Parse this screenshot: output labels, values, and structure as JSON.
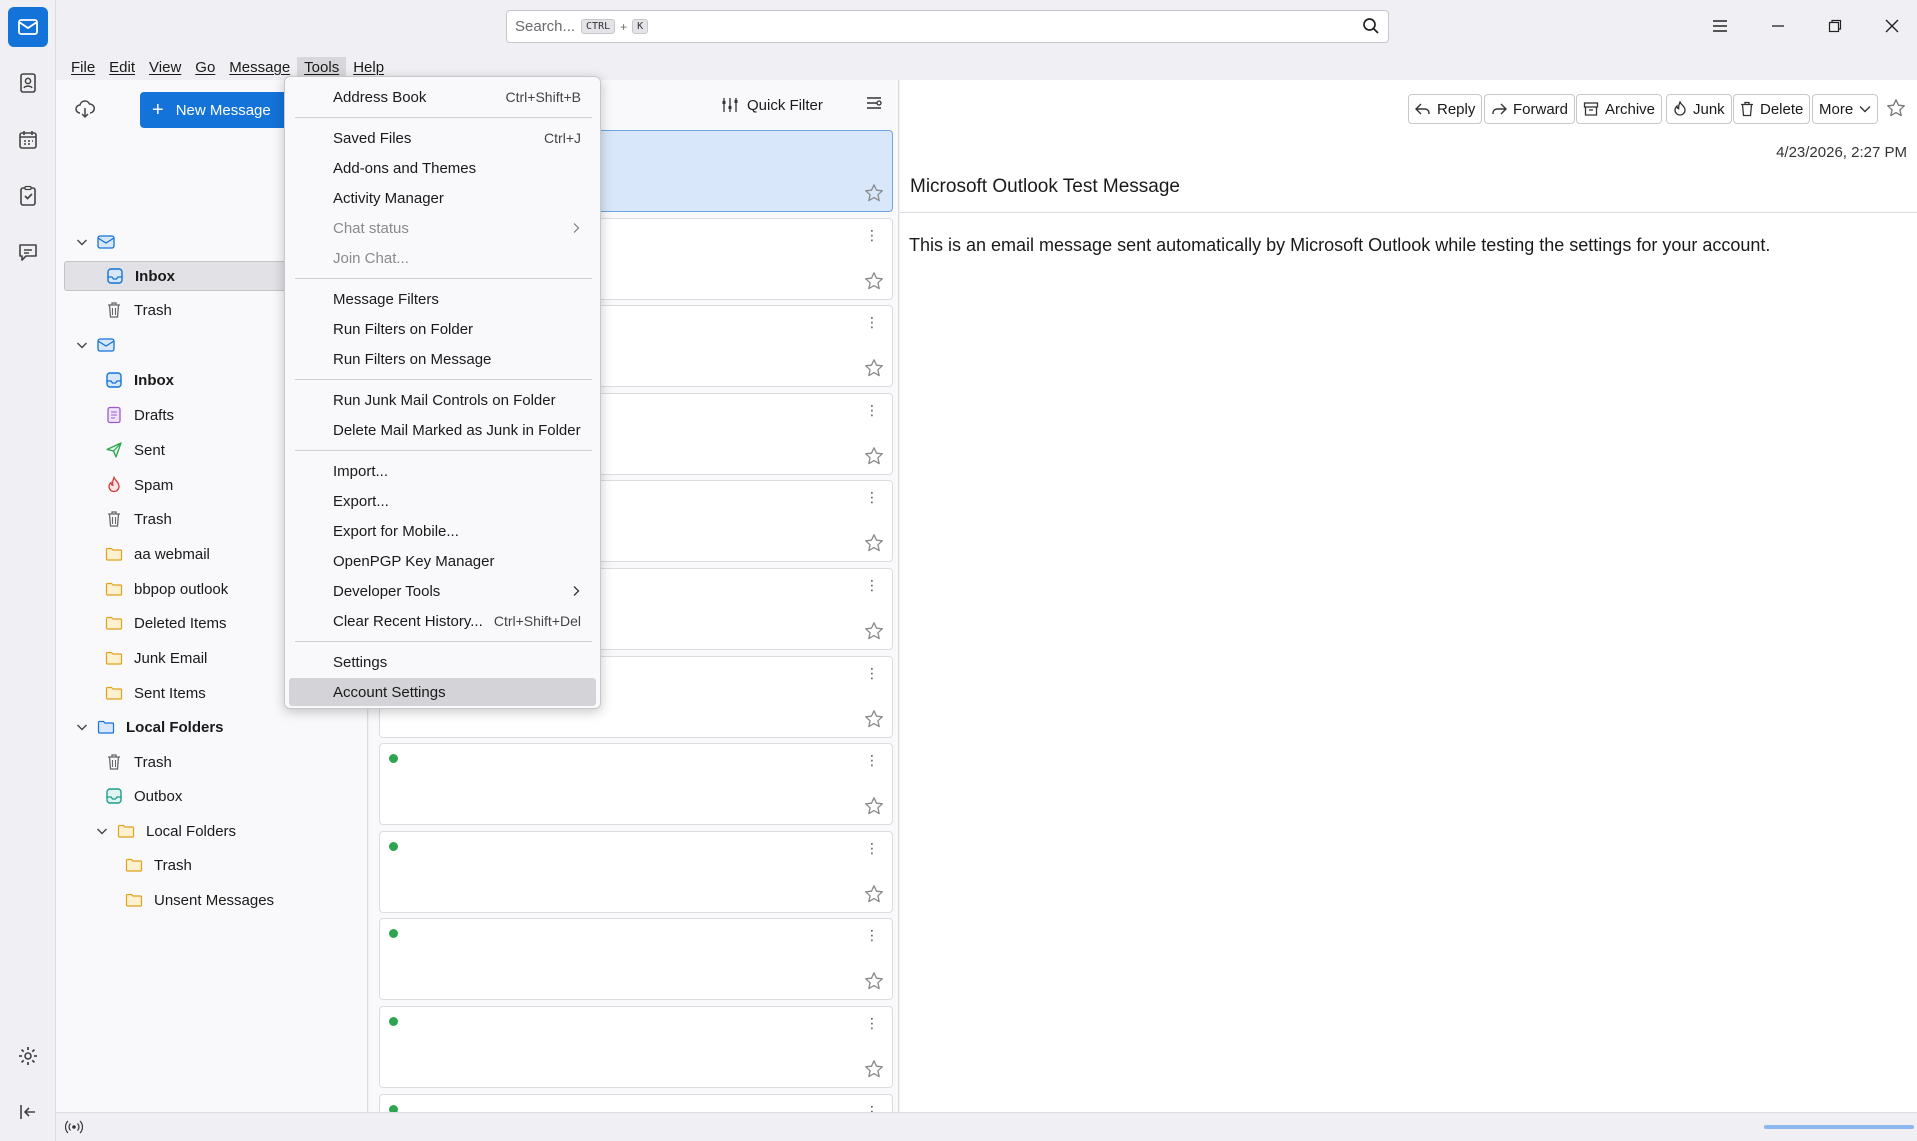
{
  "search": {
    "placeholder": "Search...",
    "shortcut_ctrl": "CTRL",
    "shortcut_plus": "+",
    "shortcut_key": "K"
  },
  "menubar": [
    "File",
    "Edit",
    "View",
    "Go",
    "Message",
    "Tools",
    "Help"
  ],
  "folders": {
    "new_message": "New Message",
    "account1": {
      "inbox": "Inbox",
      "trash": "Trash"
    },
    "account2": {
      "inbox": "Inbox",
      "drafts": "Drafts",
      "sent": "Sent",
      "spam": "Spam",
      "trash": "Trash",
      "aa_webmail": "aa webmail",
      "bbpop_outlook": "bbpop outlook",
      "deleted_items": "Deleted Items",
      "junk_email": "Junk Email",
      "sent_items": "Sent Items"
    },
    "local": {
      "title": "Local Folders",
      "trash": "Trash",
      "outbox": "Outbox",
      "sub_local": "Local Folders",
      "sub_trash": "Trash",
      "unsent": "Unsent Messages"
    }
  },
  "msglist": {
    "quick_filter": "Quick Filter"
  },
  "tools_menu": {
    "address_book": "Address Book",
    "address_book_sc": "Ctrl+Shift+B",
    "saved_files": "Saved Files",
    "saved_files_sc": "Ctrl+J",
    "addons": "Add-ons and Themes",
    "activity": "Activity Manager",
    "chat_status": "Chat status",
    "join_chat": "Join Chat...",
    "message_filters": "Message Filters",
    "run_filters_folder": "Run Filters on Folder",
    "run_filters_message": "Run Filters on Message",
    "run_junk": "Run Junk Mail Controls on Folder",
    "delete_junk": "Delete Mail Marked as Junk in Folder",
    "import": "Import...",
    "export": "Export...",
    "export_mobile": "Export for Mobile...",
    "openpgp": "OpenPGP Key Manager",
    "developer_tools": "Developer Tools",
    "clear_history": "Clear Recent History...",
    "clear_history_sc": "Ctrl+Shift+Del",
    "settings": "Settings",
    "account_settings": "Account Settings"
  },
  "message": {
    "reply": "Reply",
    "forward": "Forward",
    "archive": "Archive",
    "junk": "Junk",
    "delete": "Delete",
    "more": "More",
    "date": "4/23/2026, 2:27 PM",
    "subject": "Microsoft Outlook Test Message",
    "body": "This is an email message sent automatically by Microsoft Outlook while testing the settings for your account."
  },
  "colors": {
    "accent": "#1373d9",
    "unread_dot": "#2ea44f",
    "selected_card": "#d8e8fa"
  }
}
